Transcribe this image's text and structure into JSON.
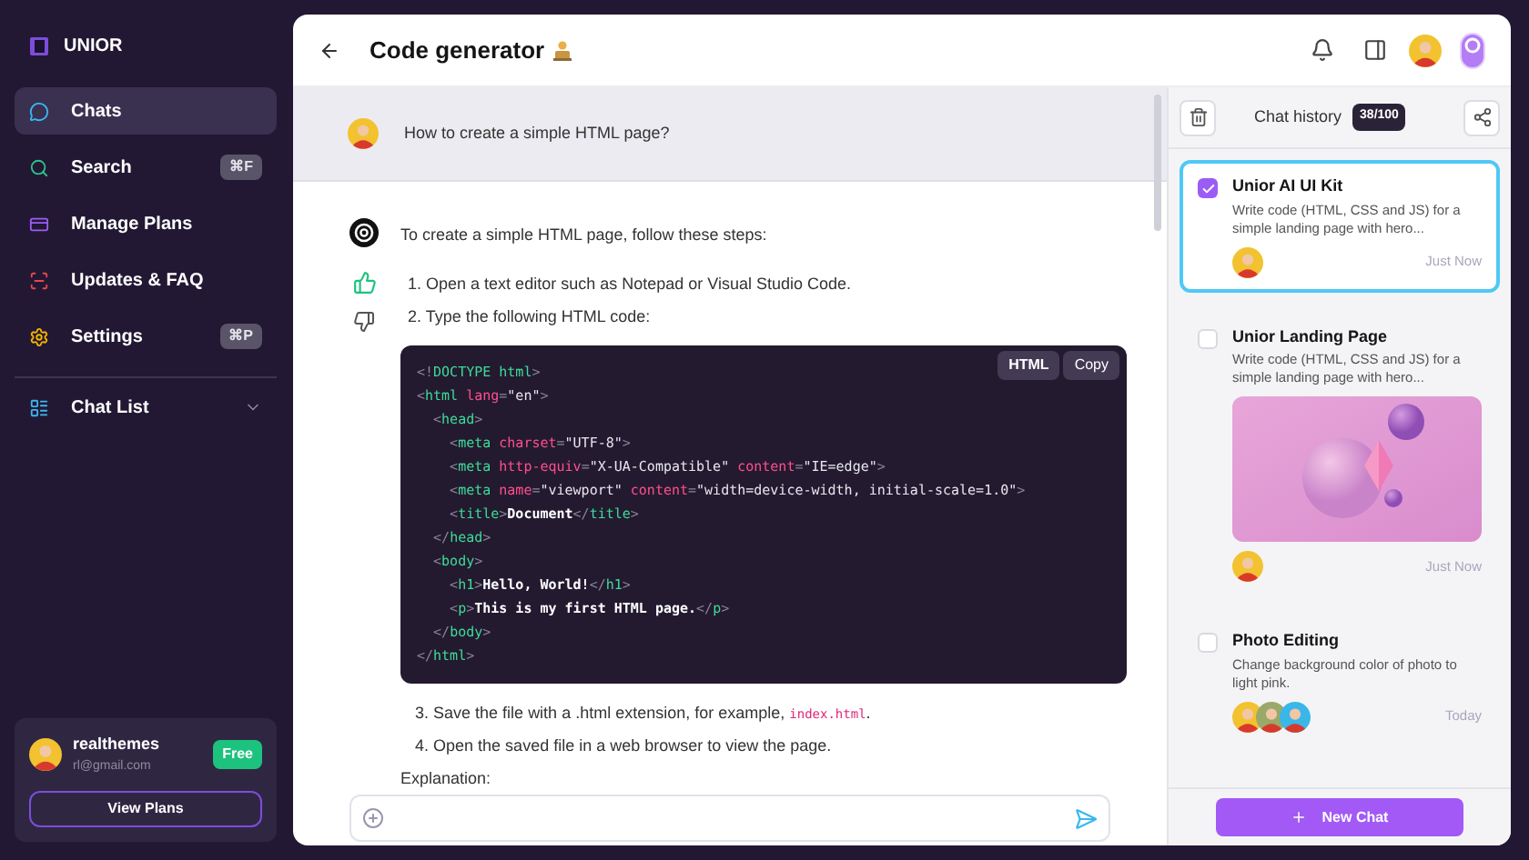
{
  "brand": {
    "name": "UNIOR"
  },
  "nav": [
    {
      "label": "Chats",
      "selected": true
    },
    {
      "label": "Search",
      "shortcut": "⌘F",
      "selected": false
    },
    {
      "label": "Manage Plans",
      "selected": false
    },
    {
      "label": "Updates & FAQ",
      "selected": false
    },
    {
      "label": "Settings",
      "shortcut": "⌘P",
      "selected": false
    }
  ],
  "chat_list": {
    "label": "Chat List",
    "expanded": false
  },
  "user": {
    "name": "realthemes",
    "email": "rl@gmail.com",
    "plan": "Free",
    "button": "View Plans"
  },
  "header": {
    "title": "Code generator"
  },
  "question": "How to create a simple HTML page?",
  "answer": {
    "intro": "To create a simple HTML page, follow these steps:",
    "liked": true,
    "steps_before": [
      {
        "number": "1.",
        "text": "Open a text editor such as Notepad or Visual Studio Code."
      },
      {
        "number": "2.",
        "text": "Type the following HTML code:"
      }
    ],
    "code": {
      "language": "HTML",
      "copy": "Copy",
      "lines": [
        [
          {
            "kind": "punct",
            "text": "<!"
          },
          {
            "kind": "tag",
            "text": "DOCTYPE html"
          },
          {
            "kind": "punct",
            "text": ">"
          }
        ],
        [
          {
            "kind": "punct",
            "text": "<"
          },
          {
            "kind": "tag",
            "text": "html "
          },
          {
            "kind": "attr",
            "text": "lang"
          },
          {
            "kind": "punct",
            "text": "="
          },
          {
            "kind": "string",
            "text": "\"en\""
          },
          {
            "kind": "punct",
            "text": ">"
          }
        ],
        [
          {
            "kind": "punct",
            "text": "  <"
          },
          {
            "kind": "tag",
            "text": "head"
          },
          {
            "kind": "punct",
            "text": ">"
          }
        ],
        [
          {
            "kind": "punct",
            "text": "    <"
          },
          {
            "kind": "tag",
            "text": "meta "
          },
          {
            "kind": "attr",
            "text": "charset"
          },
          {
            "kind": "punct",
            "text": "="
          },
          {
            "kind": "string",
            "text": "\"UTF-8\""
          },
          {
            "kind": "punct",
            "text": ">"
          }
        ],
        [
          {
            "kind": "punct",
            "text": "    <"
          },
          {
            "kind": "tag",
            "text": "meta "
          },
          {
            "kind": "attr",
            "text": "http-equiv"
          },
          {
            "kind": "punct",
            "text": "="
          },
          {
            "kind": "string",
            "text": "\"X-UA-Compatible\" "
          },
          {
            "kind": "attr",
            "text": "content"
          },
          {
            "kind": "punct",
            "text": "="
          },
          {
            "kind": "string",
            "text": "\"IE=edge\""
          },
          {
            "kind": "punct",
            "text": ">"
          }
        ],
        [
          {
            "kind": "punct",
            "text": "    <"
          },
          {
            "kind": "tag",
            "text": "meta "
          },
          {
            "kind": "attr",
            "text": "name"
          },
          {
            "kind": "punct",
            "text": "="
          },
          {
            "kind": "string",
            "text": "\"viewport\" "
          },
          {
            "kind": "attr",
            "text": "content"
          },
          {
            "kind": "punct",
            "text": "="
          },
          {
            "kind": "string",
            "text": "\"width=device-width, initial-scale=1.0\""
          },
          {
            "kind": "punct",
            "text": ">"
          }
        ],
        [
          {
            "kind": "punct",
            "text": "    <"
          },
          {
            "kind": "tag",
            "text": "title"
          },
          {
            "kind": "punct",
            "text": ">"
          },
          {
            "kind": "text",
            "text": "Document"
          },
          {
            "kind": "punct",
            "text": "</"
          },
          {
            "kind": "tag",
            "text": "title"
          },
          {
            "kind": "punct",
            "text": ">"
          }
        ],
        [
          {
            "kind": "punct",
            "text": "  </"
          },
          {
            "kind": "tag",
            "text": "head"
          },
          {
            "kind": "punct",
            "text": ">"
          }
        ],
        [
          {
            "kind": "punct",
            "text": "  <"
          },
          {
            "kind": "tag",
            "text": "body"
          },
          {
            "kind": "punct",
            "text": ">"
          }
        ],
        [
          {
            "kind": "punct",
            "text": "    <"
          },
          {
            "kind": "tag",
            "text": "h1"
          },
          {
            "kind": "punct",
            "text": ">"
          },
          {
            "kind": "text",
            "text": "Hello, World!"
          },
          {
            "kind": "punct",
            "text": "</"
          },
          {
            "kind": "tag",
            "text": "h1"
          },
          {
            "kind": "punct",
            "text": ">"
          }
        ],
        [
          {
            "kind": "punct",
            "text": "    <"
          },
          {
            "kind": "tag",
            "text": "p"
          },
          {
            "kind": "punct",
            "text": ">"
          },
          {
            "kind": "text",
            "text": "This is my first HTML page."
          },
          {
            "kind": "punct",
            "text": "</"
          },
          {
            "kind": "tag",
            "text": "p"
          },
          {
            "kind": "punct",
            "text": ">"
          }
        ],
        [
          {
            "kind": "punct",
            "text": "  </"
          },
          {
            "kind": "tag",
            "text": "body"
          },
          {
            "kind": "punct",
            "text": ">"
          }
        ],
        [
          {
            "kind": "punct",
            "text": "</"
          },
          {
            "kind": "tag",
            "text": "html"
          },
          {
            "kind": "punct",
            "text": ">"
          }
        ]
      ]
    },
    "steps_after": [
      {
        "number": "3.",
        "text": "Save the file with a .html extension, for example, ",
        "code": "index.html",
        "end": "."
      },
      {
        "number": "4.",
        "text": "Open the saved file in a web browser to view the page."
      }
    ],
    "explanation": "Explanation:"
  },
  "history": {
    "title": "Chat history",
    "count": "38/100",
    "new_chat": "New Chat",
    "items": [
      {
        "title": "Unior AI UI Kit",
        "text": "Write code (HTML, CSS and JS) for a simple landing page with hero...",
        "time": "Just Now",
        "checked": true,
        "selected": true,
        "avatars": [
          {
            "color": "#f2c230"
          }
        ]
      },
      {
        "title": "Unior Landing Page",
        "text": "Write code (HTML, CSS and JS) for a simple landing page with hero...",
        "time": "Just Now",
        "checked": false,
        "selected": false,
        "attachment": {
          "kind": "picture"
        },
        "avatars": [
          {
            "color": "#f2c230"
          }
        ]
      },
      {
        "title": "Photo Editing",
        "text": "Change background color of photo to light pink.",
        "time": "Today",
        "checked": false,
        "selected": false,
        "avatars": [
          {
            "color": "#f2c230"
          },
          {
            "color": "#9aa86a"
          },
          {
            "color": "#3ab7e8"
          }
        ]
      }
    ]
  }
}
